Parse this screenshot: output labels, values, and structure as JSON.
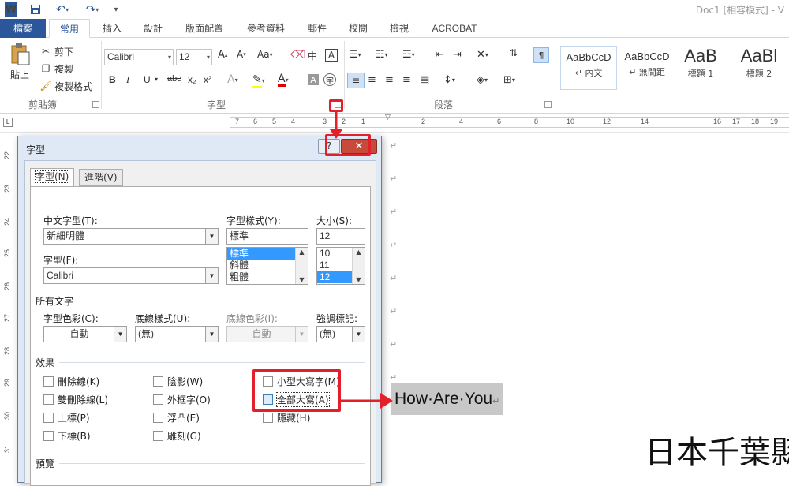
{
  "window": {
    "title": "Doc1 [相容模式] - V"
  },
  "quick_access": {
    "app_icon": "W",
    "save_icon": "save-icon",
    "undo_icon": "undo-icon",
    "redo_icon": "redo-icon"
  },
  "tabs": [
    "檔案",
    "常用",
    "插入",
    "設計",
    "版面配置",
    "參考資料",
    "郵件",
    "校閱",
    "檢視",
    "ACROBAT"
  ],
  "ribbon": {
    "clipboard": {
      "paste": "貼上",
      "cut": "剪下",
      "copy": "複製",
      "format_painter": "複製格式",
      "label": "剪貼簿"
    },
    "font": {
      "font_name": "Calibri",
      "font_size": "12",
      "label": "字型",
      "bold": "B",
      "italic": "I",
      "underline": "U",
      "strike": "abc",
      "sub": "x₂",
      "sup": "x²"
    },
    "paragraph": {
      "label": "段落"
    },
    "styles": [
      {
        "sample": "AaBbCcD",
        "name": "↵ 內文"
      },
      {
        "sample": "AaBbCcD",
        "name": "↵ 無間距"
      },
      {
        "sample": "AaB",
        "name": "標題 1"
      },
      {
        "sample": "AaBl",
        "name": "標題 2"
      }
    ]
  },
  "ruler": {
    "top": [
      "7",
      "6",
      "5",
      "4",
      "3",
      "2",
      "1",
      "2",
      "4",
      "6",
      "8",
      "10",
      "12",
      "14",
      "16",
      "17",
      "18",
      "19"
    ],
    "left": [
      "22",
      "23",
      "24",
      "25",
      "26",
      "27",
      "28",
      "29",
      "30",
      "31"
    ]
  },
  "dialog": {
    "title": "字型",
    "help": "?",
    "close": "✕",
    "tabs": {
      "font": "字型(N)",
      "advanced": "進階(V)"
    },
    "cjk_font_label": "中文字型(T):",
    "cjk_font_value": "新細明體",
    "font_label": "字型(F):",
    "font_value": "Calibri",
    "style_label": "字型樣式(Y):",
    "style_value": "標準",
    "style_list": [
      "標準",
      "斜體",
      "粗體"
    ],
    "size_label": "大小(S):",
    "size_value": "12",
    "size_list": [
      "10",
      "11",
      "12"
    ],
    "all_text": "所有文字",
    "color_label": "字型色彩(C):",
    "color_value": "自動",
    "underline_style_label": "底線樣式(U):",
    "underline_style_value": "(無)",
    "underline_color_label": "底線色彩(I):",
    "underline_color_value": "自動",
    "emphasis_label": "強調標記:",
    "emphasis_value": "(無)",
    "effects": "效果",
    "effects_items": {
      "strikethrough": "刪除線(K)",
      "double_strike": "雙刪除線(L)",
      "superscript": "上標(P)",
      "subscript": "下標(B)",
      "shadow": "陰影(W)",
      "outline": "外框字(O)",
      "emboss": "浮凸(E)",
      "engrave": "雕刻(G)",
      "small_caps": "小型大寫字(M)",
      "all_caps": "全部大寫(A)",
      "hidden": "隱藏(H)"
    },
    "preview": "預覽"
  },
  "document": {
    "sample_text": "How·Are·You",
    "cjk_text": "日本千葉縣",
    "para_mark": "↵"
  },
  "annotation_color": "#e2202c"
}
